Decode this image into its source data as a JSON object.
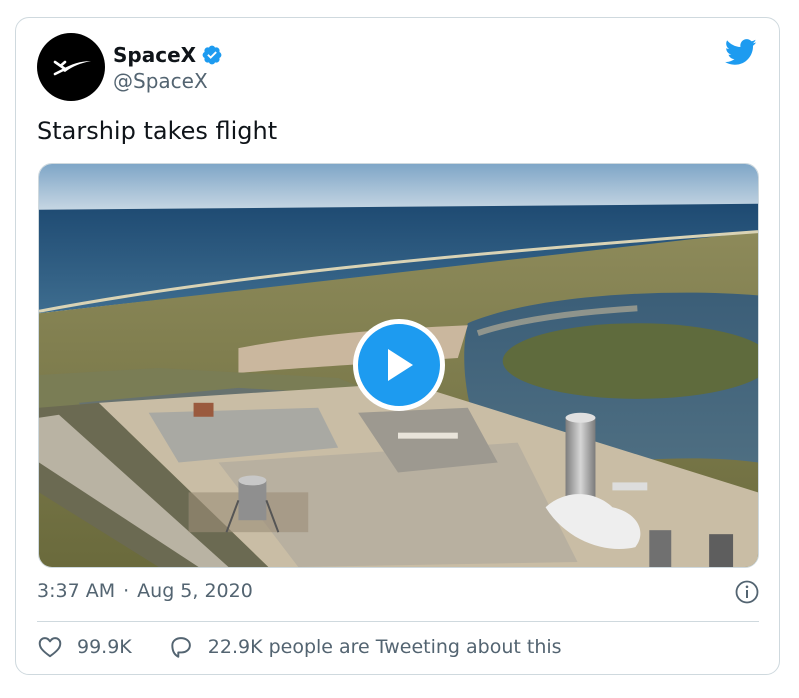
{
  "tweet": {
    "author": {
      "display_name": "SpaceX",
      "handle": "@SpaceX",
      "verified": true,
      "avatar_icon": "spacex-logo-icon"
    },
    "text": "Starship takes flight",
    "media": {
      "kind": "video",
      "play_icon": "play-icon"
    },
    "time": "3:37 AM",
    "separator": "·",
    "date": "Aug 5, 2020",
    "likes": "99.9K",
    "tweeting": "22.9K people are Tweeting about this"
  },
  "icons": {
    "brand": "twitter-bird-icon",
    "info": "info-icon",
    "like": "heart-icon",
    "reply": "speech-bubble-icon",
    "verified": "verified-badge-icon"
  },
  "colors": {
    "accent": "#1d9bf0",
    "text": "#0f1419",
    "secondary_text": "#536471",
    "border": "#cfd9de"
  }
}
